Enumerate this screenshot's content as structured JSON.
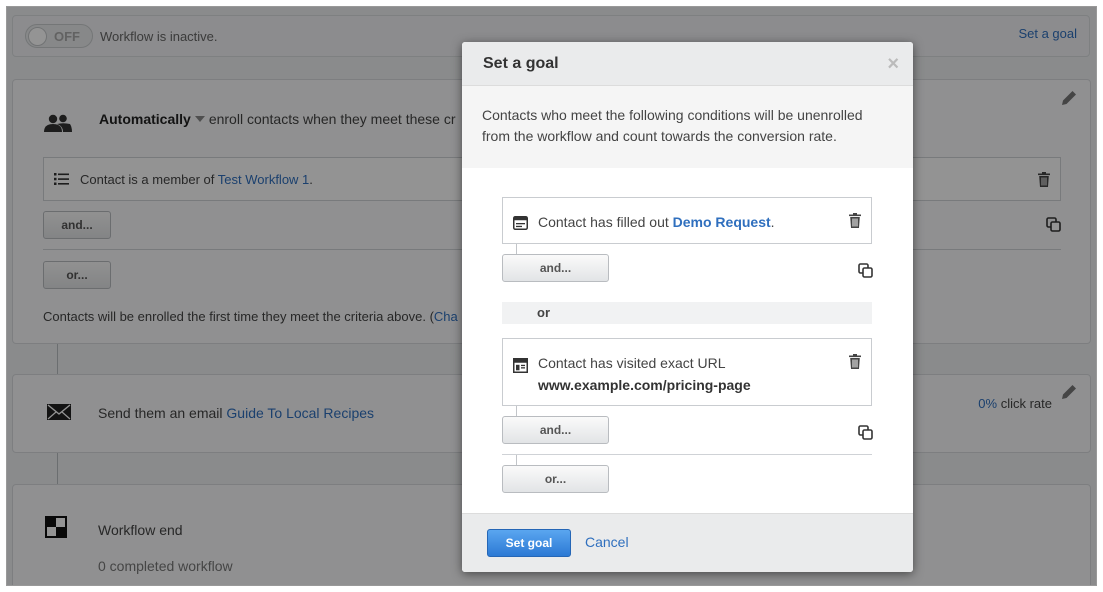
{
  "topbar": {
    "toggle_label": "OFF",
    "status_text": "Workflow is inactive.",
    "set_goal_link": "Set a goal"
  },
  "enrollment": {
    "mode": "Automatically",
    "enroll_text": "enroll contacts when they meet these cr",
    "criteria_prefix": "Contact is a member of ",
    "criteria_list": "Test Workflow 1",
    "criteria_suffix": ".",
    "and_button": "and...",
    "or_button": "or...",
    "note_prefix": "Contacts will be enrolled the first time they meet the criteria above. (",
    "note_link": "Cha"
  },
  "email_step": {
    "prefix": "Send them an email ",
    "email_name": "Guide To Local Recipes",
    "click_rate_pct": "0%",
    "click_rate_label": " click rate"
  },
  "end_step": {
    "title": "Workflow end",
    "subtitle": "0 completed workflow"
  },
  "modal": {
    "title": "Set a goal",
    "close_glyph": "×",
    "description": "Contacts who meet the following conditions will be unenrolled from the workflow and count towards the conversion rate.",
    "condition1": {
      "prefix": "Contact has filled out ",
      "form_name": "Demo Request",
      "suffix": "."
    },
    "condition2": {
      "line1": "Contact has visited exact URL",
      "url": "www.example.com/pricing-page"
    },
    "and_button": "and...",
    "or_separator": "or",
    "or_button": "or...",
    "primary_button": "Set goal",
    "cancel_link": "Cancel"
  },
  "colors": {
    "link": "#2f6fbe",
    "primary": "#2c79d4",
    "overlay": "rgba(0,0,0,0.42)"
  },
  "icons": [
    "people-icon",
    "list-icon",
    "trash-icon",
    "copy-icon",
    "pencil-icon",
    "mail-icon",
    "workflow-end-icon",
    "form-icon",
    "page-icon",
    "close-icon"
  ]
}
